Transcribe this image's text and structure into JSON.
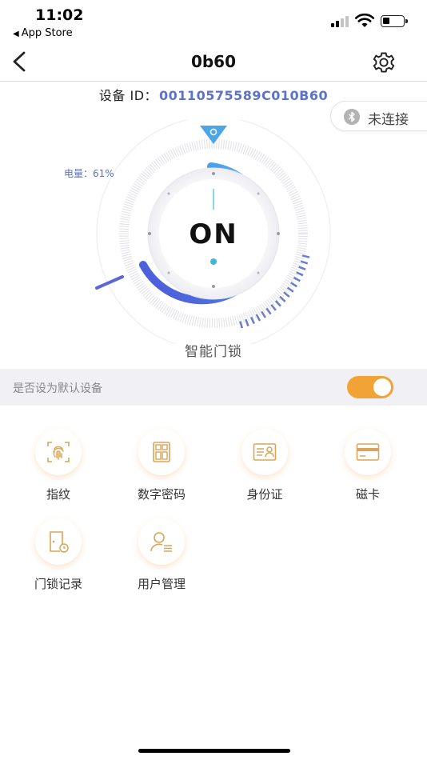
{
  "status_bar": {
    "time": "11:02",
    "back_app": "App Store"
  },
  "nav": {
    "title": "0b60",
    "back_icon": "chevron-left-icon",
    "settings_icon": "gear-icon"
  },
  "device": {
    "id_label": "设备 ID：",
    "id_value": "00110575589C010B60"
  },
  "connection": {
    "status": "未连接",
    "icon": "bluetooth-icon"
  },
  "dial": {
    "battery_label": "电量：61%",
    "battery_percent": 61,
    "state": "ON",
    "caption": "智能门锁"
  },
  "default_device": {
    "label": "是否设为默认设备",
    "enabled": true
  },
  "features": [
    {
      "label": "指纹",
      "icon": "fingerprint-icon"
    },
    {
      "label": "数字密码",
      "icon": "keypad-icon"
    },
    {
      "label": "身份证",
      "icon": "id-card-icon"
    },
    {
      "label": "磁卡",
      "icon": "card-icon"
    },
    {
      "label": "门锁记录",
      "icon": "door-record-icon"
    },
    {
      "label": "用户管理",
      "icon": "user-manage-icon"
    }
  ],
  "colors": {
    "accent_blue": "#5d72c9",
    "accent_orange": "#f1a336",
    "icon_gold": "#d9a55a"
  }
}
